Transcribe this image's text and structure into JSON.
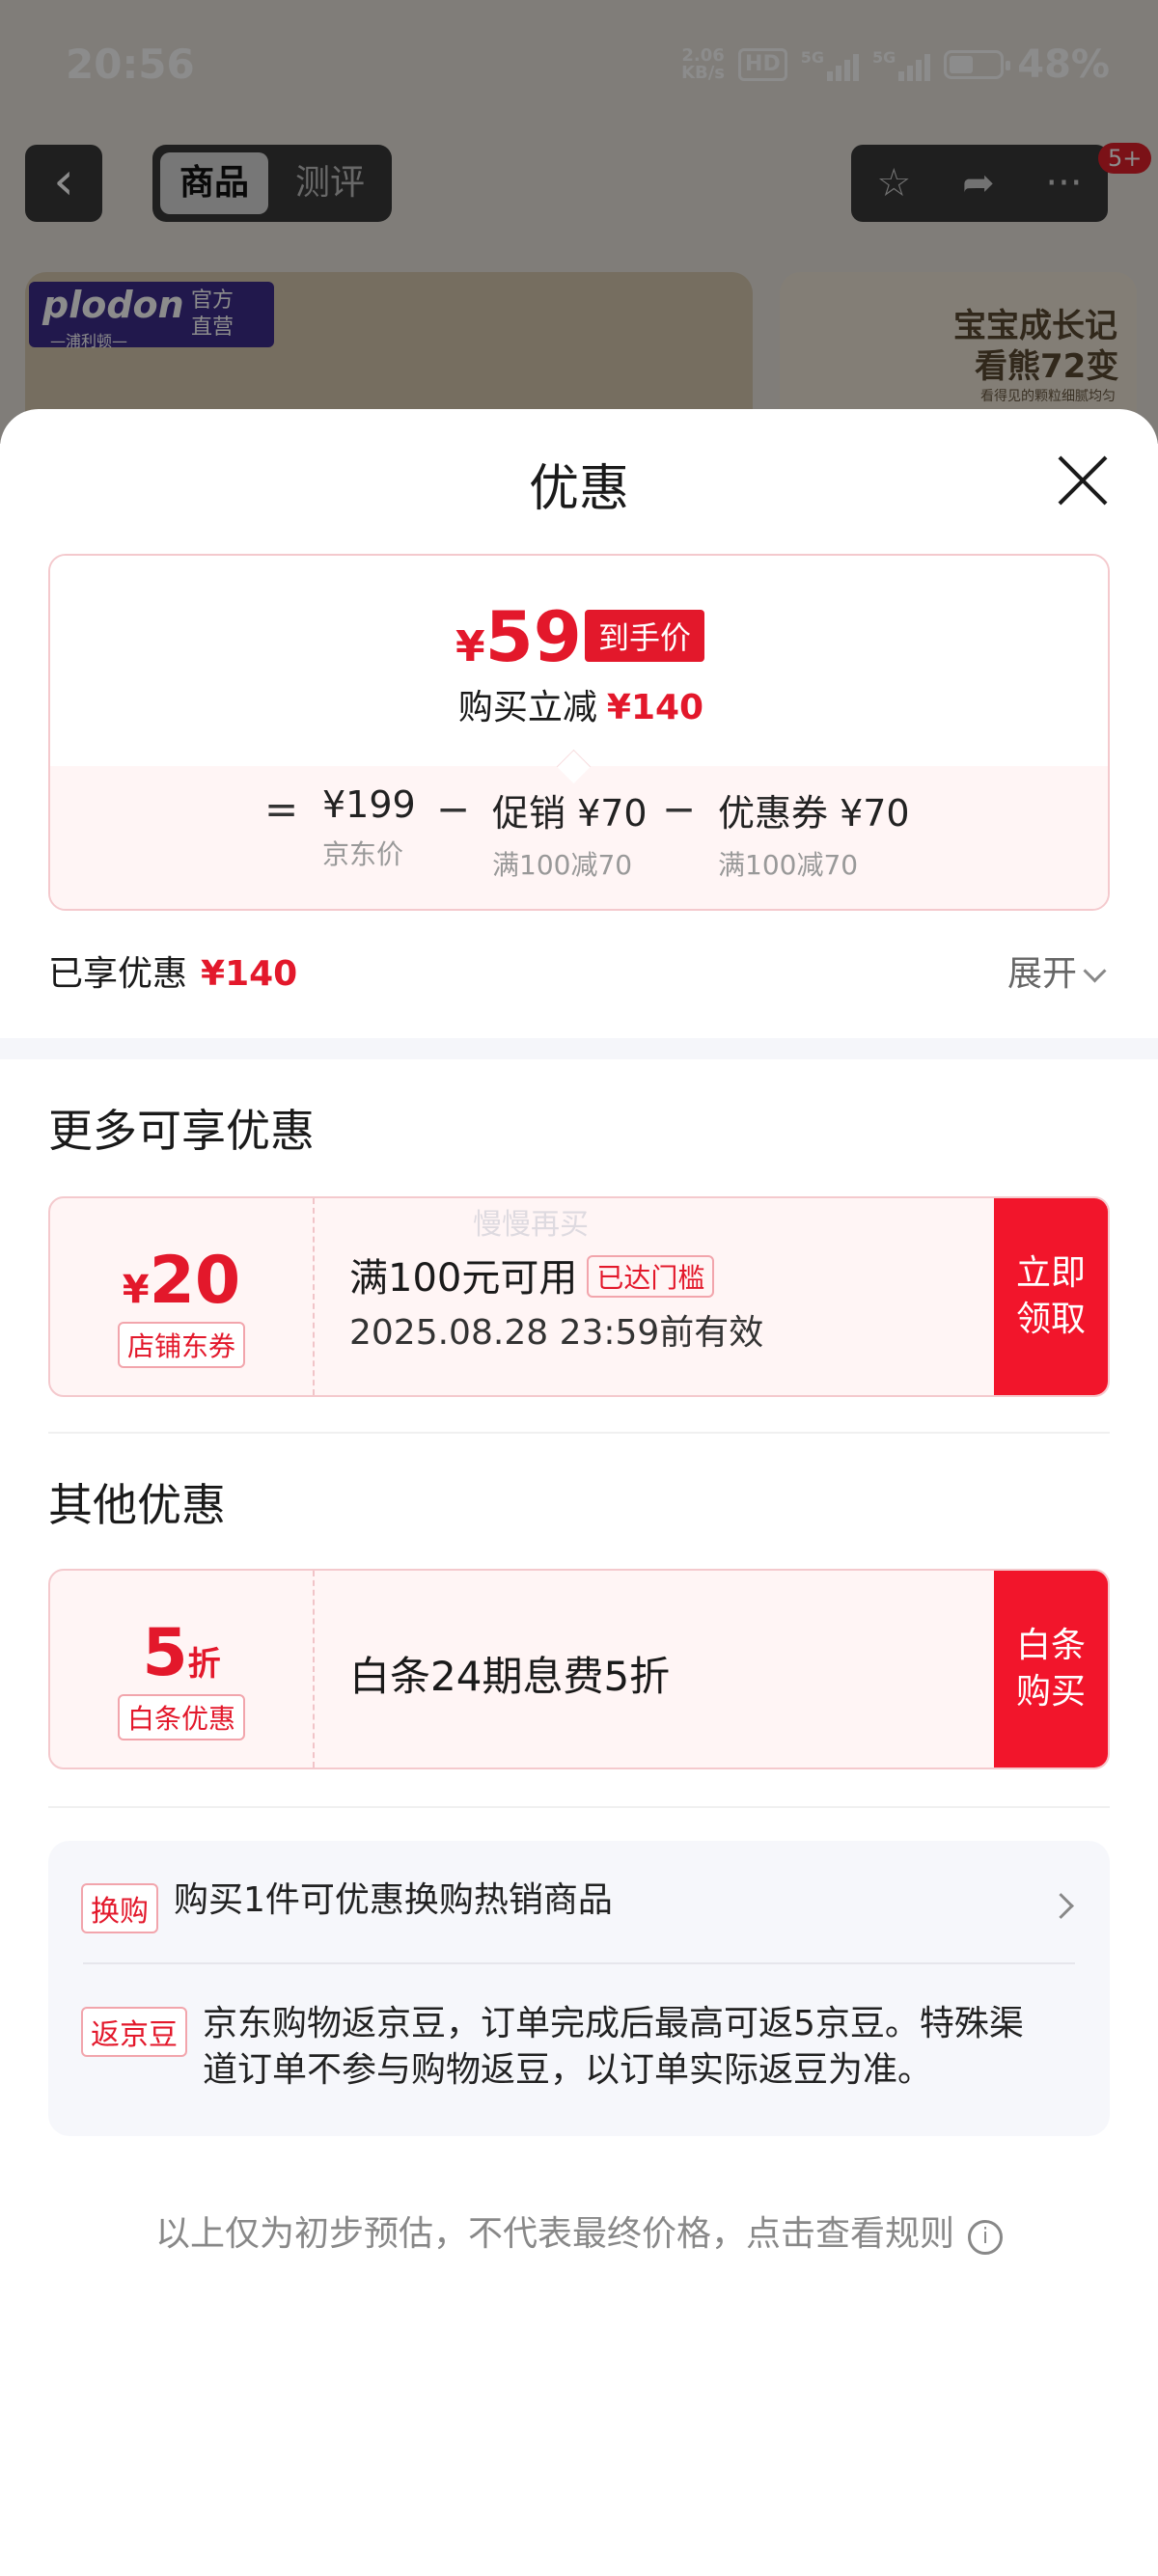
{
  "status_bar": {
    "time": "20:56",
    "net_speed_value": "2.06",
    "net_speed_unit": "KB/s",
    "hd_label": "HD",
    "signal_1_label": "5G",
    "signal_2_label": "5G",
    "battery_percent": "48%",
    "battery_level": 0.48
  },
  "product_page": {
    "tabs": [
      "商品",
      "测评"
    ],
    "active_tab": "商品",
    "more_badge": "5+",
    "brand_name": "plodon",
    "brand_sub": "—浦利顿—",
    "brand_official_line1": "官方",
    "brand_official_line2": "直营",
    "promo_line1": "宝宝成长记",
    "promo_line2": "看熊72变",
    "promo_line3": "看得见的颗粒细腻均匀"
  },
  "sheet": {
    "title": "优惠",
    "price_card": {
      "currency": "¥",
      "final_price": "59",
      "final_tag": "到手价",
      "reduce_label": "购买立减",
      "reduce_amount": "¥140",
      "equals": "=",
      "minus": "−",
      "items": [
        {
          "main": "¥199",
          "sub": "京东价"
        },
        {
          "main": "促销 ¥70",
          "sub": "满100减70"
        },
        {
          "main": "优惠券 ¥70",
          "sub": "满100减70"
        }
      ]
    },
    "enjoyed_label": "已享优惠",
    "enjoyed_amount": "¥140",
    "expand_label": "展开",
    "more_title": "更多可享优惠",
    "coupon": {
      "currency": "¥",
      "value": "20",
      "tag": "店铺东券",
      "condition": "满100元可用",
      "status_badge": "已达门槛",
      "validity": "2025.08.28 23:59前有效",
      "button": "立即领取"
    },
    "watermark": "慢慢再买",
    "other_title": "其他优惠",
    "baitiao": {
      "value": "5",
      "unit": "折",
      "tag": "白条优惠",
      "description": "白条24期息费5折",
      "button": "白条购买"
    },
    "info": {
      "swap_tag": "换购",
      "swap_text": "购买1件可优惠换购热销商品",
      "bean_tag": "返京豆",
      "bean_text_line1": "京东购物返京豆，订单完成后最高可返5京豆。特殊渠",
      "bean_text_line2": "道订单不参与购物返豆，以订单实际返豆为准。"
    },
    "disclaimer": "以上仅为初步预估，不代表最终价格，点击查看规则"
  },
  "colors": {
    "accent_red": "#e3182b",
    "button_red": "#f2152b",
    "tag_border": "#f2a5ac",
    "card_bg": "#fff5f5"
  },
  "icons": [
    "back-arrow-icon",
    "star-icon",
    "share-icon",
    "more-dots-icon",
    "close-icon",
    "chevron-down-icon",
    "chevron-right-icon",
    "info-icon",
    "battery-icon",
    "signal-icon"
  ]
}
